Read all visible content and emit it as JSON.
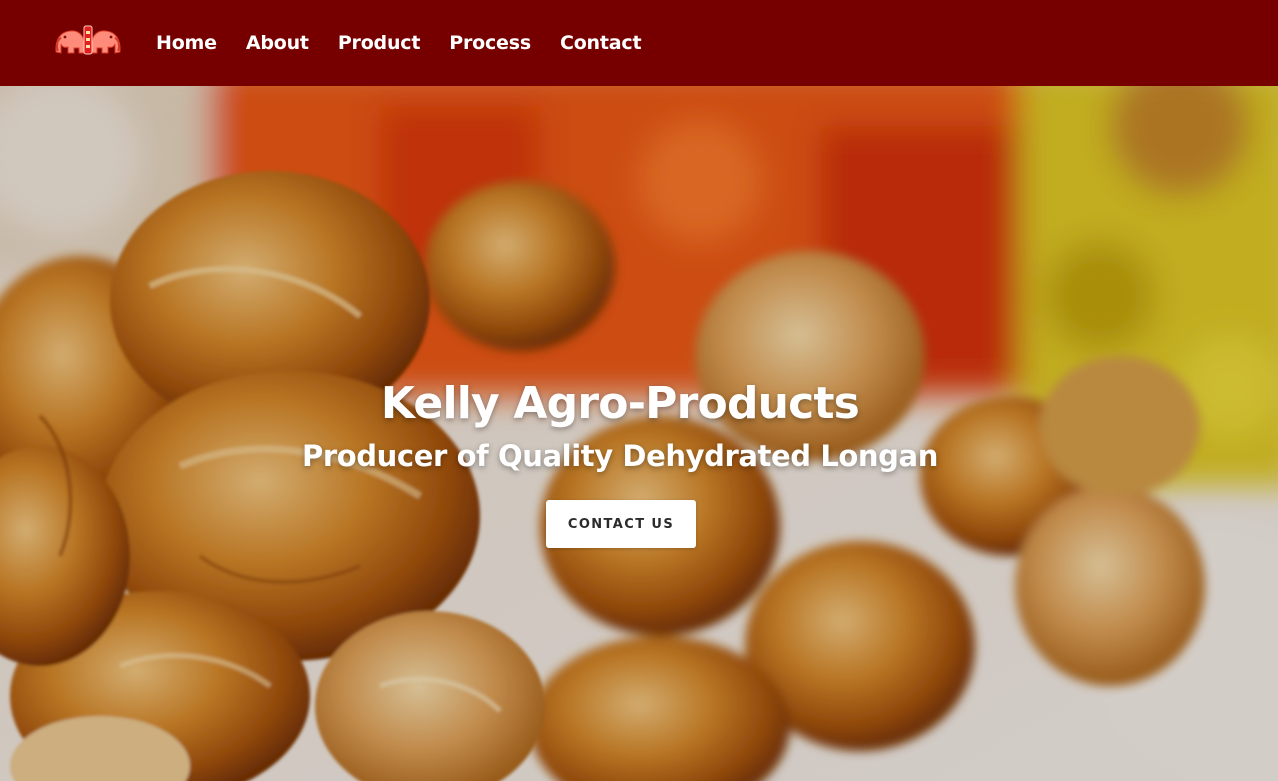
{
  "header": {
    "logo_icon": "twin-elephants-logo-icon",
    "nav": [
      {
        "label": "Home"
      },
      {
        "label": "About"
      },
      {
        "label": "Product"
      },
      {
        "label": "Process"
      },
      {
        "label": "Contact"
      }
    ]
  },
  "hero": {
    "background": "photo-dried-longan",
    "title": "Kelly Agro-Products",
    "subtitle": "Producer of Quality Dehydrated Longan",
    "cta_label": "CONTACT US"
  },
  "colors": {
    "navbar": "#760000",
    "nav_text": "#ffffff",
    "cta_background": "#ffffff",
    "cta_text": "#2b2b2b",
    "longan_amber": "#c97a1c",
    "bag_orange": "#f05a14",
    "bag_yellow": "#e8d21e"
  }
}
